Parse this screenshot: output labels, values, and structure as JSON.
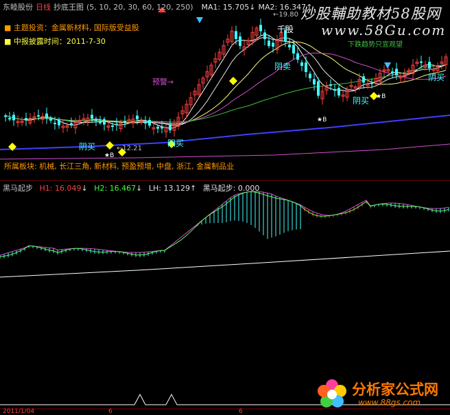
{
  "header": {
    "stock_name": "东睦股份",
    "period": "日线",
    "indicator": "抄底王图",
    "params": "(5, 10, 20, 30, 60, 120, 250)",
    "ma1_label": "MA1: 15.705",
    "ma1_arrow": "↓",
    "ma2_label": "MA2: 16.347",
    "ma2_arrow": "↑"
  },
  "info": {
    "theme_investment": "主题投资：金属新材料, 国际版受益股",
    "report_time": "中报披露时间：2011-7-30",
    "sector": "所属板块: 机械, 长江三角, 新材料, 预盈预增, 中盘, 浙江, 金属制品业"
  },
  "annotations": {
    "high_value": "19.80",
    "low_value": "12.21",
    "warning": "预警",
    "yang_buy_1": "阴买",
    "yang_buy_2": "阳买",
    "yang_buy_3": "阴买",
    "yang_buy_4": "阴买",
    "yang_sell": "阴卖",
    "thousand_stock": "千股",
    "trend_note": "下跌趋势只宜观望",
    "star_mark": "★B"
  },
  "lower_panel": {
    "title": "黑马起步",
    "h1_label": "H1: 16.049",
    "h1_arrow": "↓",
    "h2_label": "H2: 16.467",
    "h2_arrow": "↓",
    "lh_label": "LH: 13.129",
    "lh_arrow": "↑",
    "start_label": "黑马起步: 0.000"
  },
  "axis": {
    "date_start": "2011/1/04",
    "mid_label_1": "6",
    "mid_label_2": "6"
  },
  "watermark": {
    "line1": "炒股輔助教材58股网",
    "line2": "www.58Gu.com"
  },
  "logo": {
    "name": "分析家公式网",
    "url": "www.88gs.com"
  },
  "colors": {
    "background": "#000000",
    "up_candle": "#ff4040",
    "down_candle": "#40ffff",
    "ma5": "#ffffff",
    "ma_purple": "#d050d0",
    "ma_green": "#40c040",
    "ma_blue": "#4040ff",
    "signal_yellow": "#ffff00",
    "info_orange": "#ff9900",
    "indicator_cyan": "#40ffff",
    "indicator_red": "#ff3030",
    "indicator_green": "#60ff60"
  },
  "chart_data": {
    "type": "line",
    "title": "抄底王图",
    "price_markers": {
      "high": 19.8,
      "low": 12.21
    },
    "ma_values": {
      "MA1": 15.705,
      "MA2": 16.347
    },
    "indicator_values": {
      "H1": 16.049,
      "H2": 16.467,
      "LH": 13.129,
      "黑马起步": 0.0
    }
  }
}
